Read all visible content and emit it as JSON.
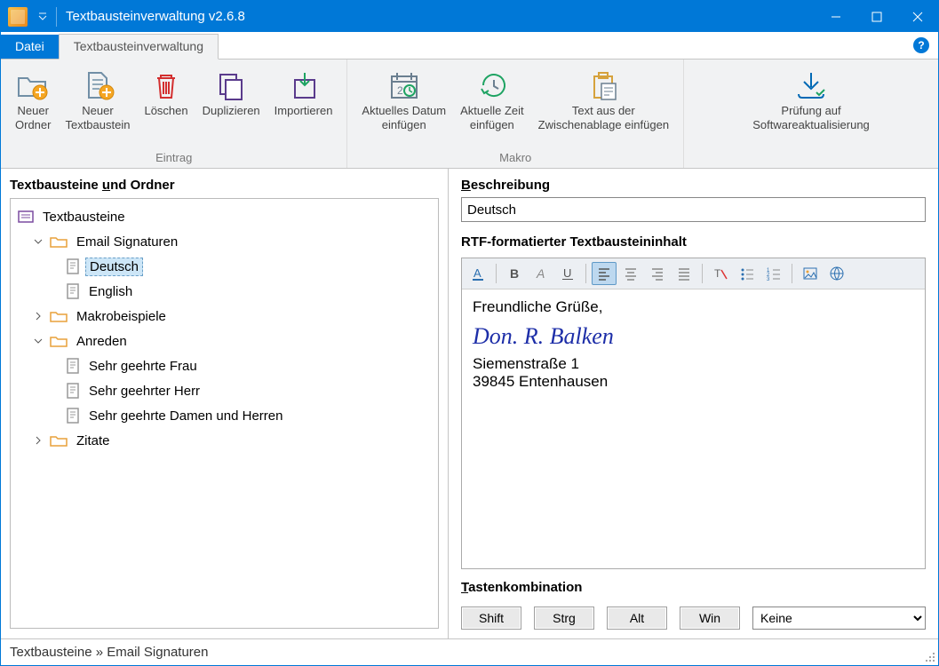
{
  "window": {
    "title": "Textbausteinverwaltung v2.6.8"
  },
  "tabs": {
    "file": "Datei",
    "main": "Textbausteinverwaltung"
  },
  "ribbon": {
    "groups": [
      {
        "label": "Eintrag"
      },
      {
        "label": "Makro"
      },
      {
        "label": ""
      }
    ],
    "entry": {
      "new_folder": "Neuer\nOrdner",
      "new_snippet": "Neuer\nTextbaustein",
      "delete": "Löschen",
      "duplicate": "Duplizieren",
      "import": "Importieren"
    },
    "macro": {
      "date": "Aktuelles Datum\neinfügen",
      "time": "Aktuelle Zeit\neinfügen",
      "clipboard": "Text aus der\nZwischenablage einfügen"
    },
    "update": {
      "check": "Prüfung auf\nSoftwareaktualisierung"
    }
  },
  "left": {
    "heading_pre": "Textbausteine ",
    "heading_ul": "u",
    "heading_post": "nd Ordner",
    "root": "Textbausteine",
    "nodes": {
      "email_sig": "Email Signaturen",
      "deutsch": "Deutsch",
      "english": "English",
      "makro": "Makrobeispiele",
      "anreden": "Anreden",
      "sgf": "Sehr geehrte Frau",
      "sgh": "Sehr geehrter Herr",
      "sgdh": "Sehr geehrte Damen und Herren",
      "zitate": "Zitate"
    }
  },
  "right": {
    "desc_label_ul": "B",
    "desc_label_rest": "eschreibung",
    "desc_value": "Deutsch",
    "rtf_label": "RTF-formatierter Textbausteininhalt",
    "content": {
      "line1": "Freundliche Grüße,",
      "sig_name": "Don. R. Balken",
      "addr1": "Siemenstraße 1",
      "addr2": "39845 Entenhausen"
    },
    "keys_label_ul": "T",
    "keys_label_rest": "astenkombination",
    "keybuttons": {
      "shift": "Shift",
      "ctrl": "Strg",
      "alt": "Alt",
      "win": "Win"
    },
    "key_select": "Keine"
  },
  "status": {
    "path": "Textbausteine » Email Signaturen"
  }
}
